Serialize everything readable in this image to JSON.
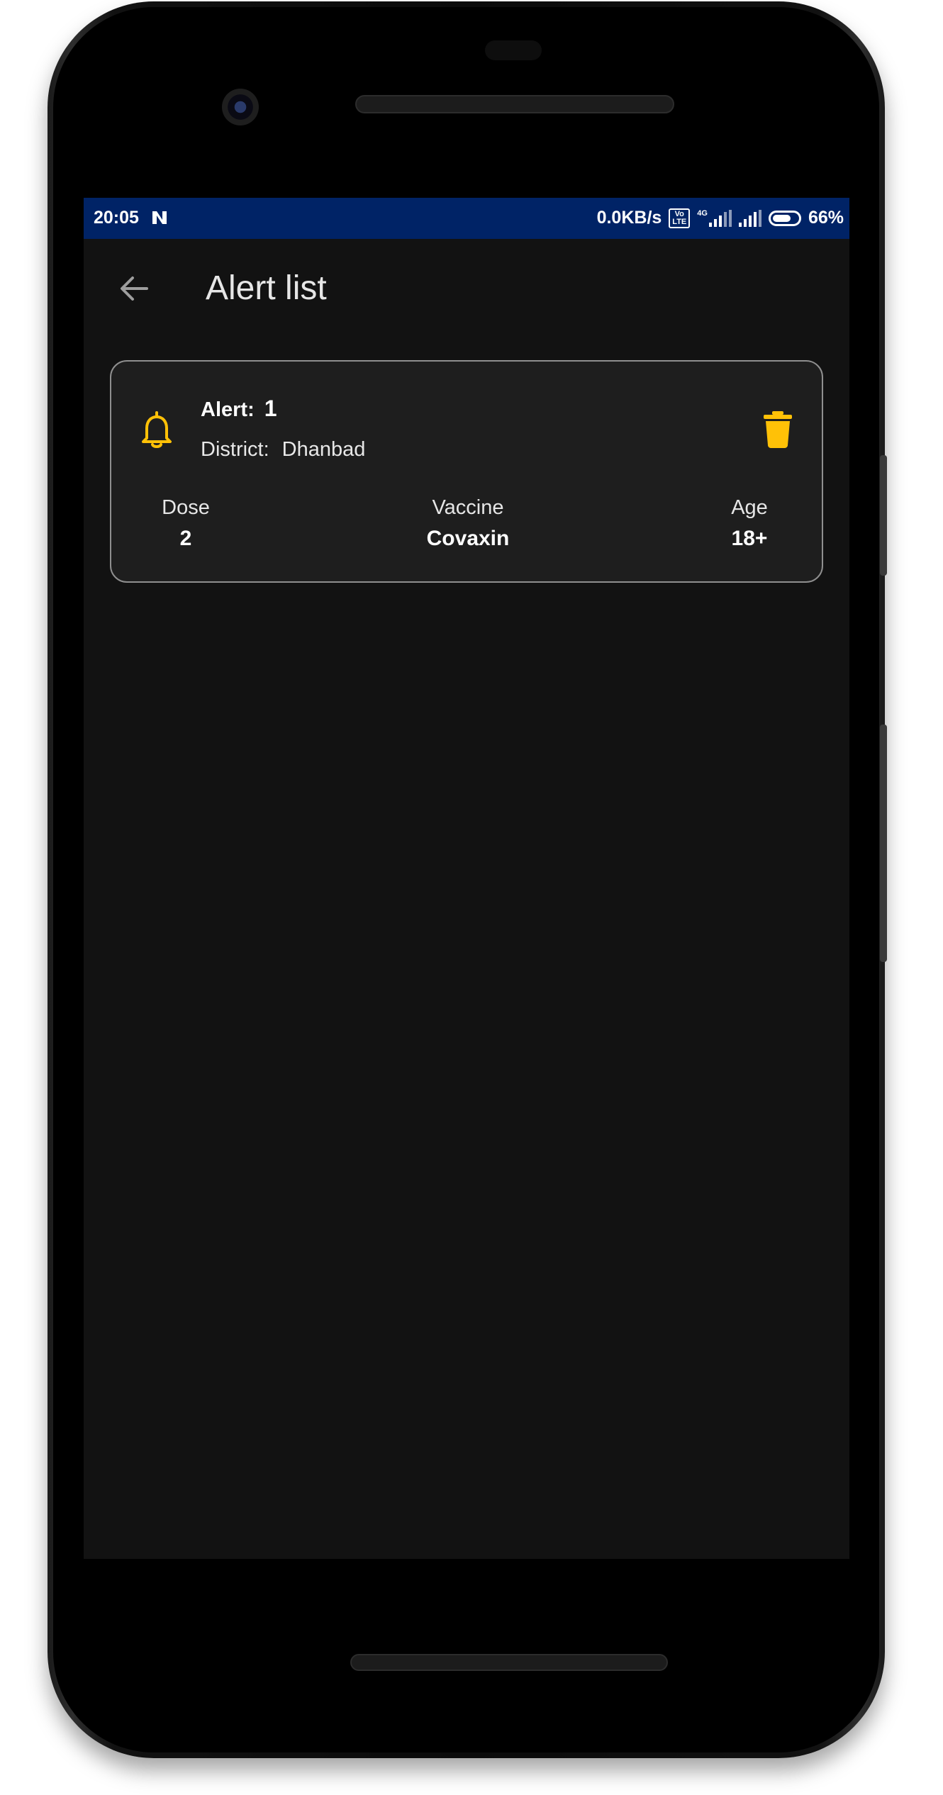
{
  "status_bar": {
    "time": "20:05",
    "network_speed": "0.0KB/s",
    "volte_top": "Vo",
    "volte_bottom": "LTE",
    "network_type": "4G",
    "battery": "66%"
  },
  "app_bar": {
    "title": "Alert list"
  },
  "alerts": [
    {
      "alert_label": "Alert:",
      "alert_number": "1",
      "district_label": "District:",
      "district_value": "Dhanbad",
      "dose_label": "Dose",
      "dose_value": "2",
      "vaccine_label": "Vaccine",
      "vaccine_value": "Covaxin",
      "age_label": "Age",
      "age_value": "18+"
    }
  ],
  "colors": {
    "status_bar": "#002366",
    "background": "#121212",
    "card": "#1e1e1e",
    "accent": "#FFC107"
  },
  "icons": {
    "back": "arrow-back-icon",
    "alert": "bell-icon",
    "delete": "trash-icon"
  }
}
